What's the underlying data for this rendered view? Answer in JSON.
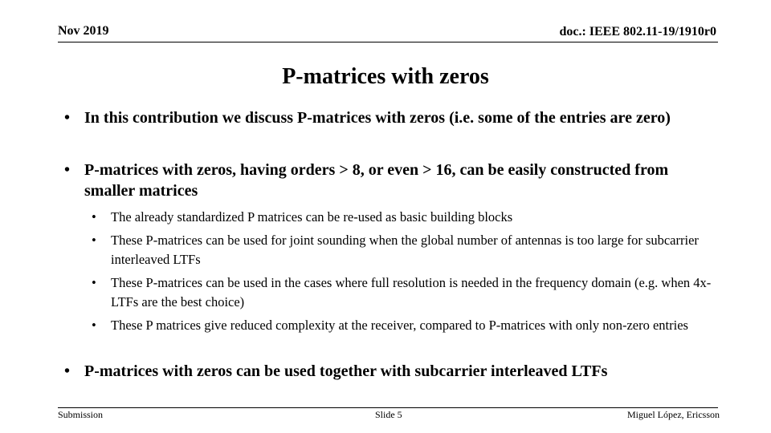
{
  "header": {
    "date": "Nov 2019",
    "doc_id": "doc.: IEEE 802.11-19/1910r0"
  },
  "title": "P-matrices with zeros",
  "bullets": [
    {
      "level": 1,
      "text": "In this contribution we discuss P-matrices with zeros (i.e. some of the entries are zero)"
    },
    {
      "level": 1,
      "text": "P-matrices with zeros, having orders > 8, or even > 16, can be easily constructed from smaller matrices"
    },
    {
      "level": 2,
      "text": "The already standardized P matrices can be re-used as basic building blocks"
    },
    {
      "level": 2,
      "text": "These P-matrices can be used for joint sounding when the global number of antennas is too large for subcarrier interleaved LTFs"
    },
    {
      "level": 2,
      "text": "These P-matrices can be used in the cases where full resolution is needed in the frequency domain (e.g. when 4x-LTFs are the best choice)"
    },
    {
      "level": 2,
      "text": "These P matrices give reduced complexity at the receiver, compared to P-matrices with only non-zero entries"
    },
    {
      "level": 1,
      "text": "P-matrices with zeros can be used together with subcarrier interleaved LTFs"
    }
  ],
  "bullet_glyph": "•",
  "footer": {
    "left": "Submission",
    "center": "Slide 5",
    "right": "Miguel López, Ericsson"
  }
}
